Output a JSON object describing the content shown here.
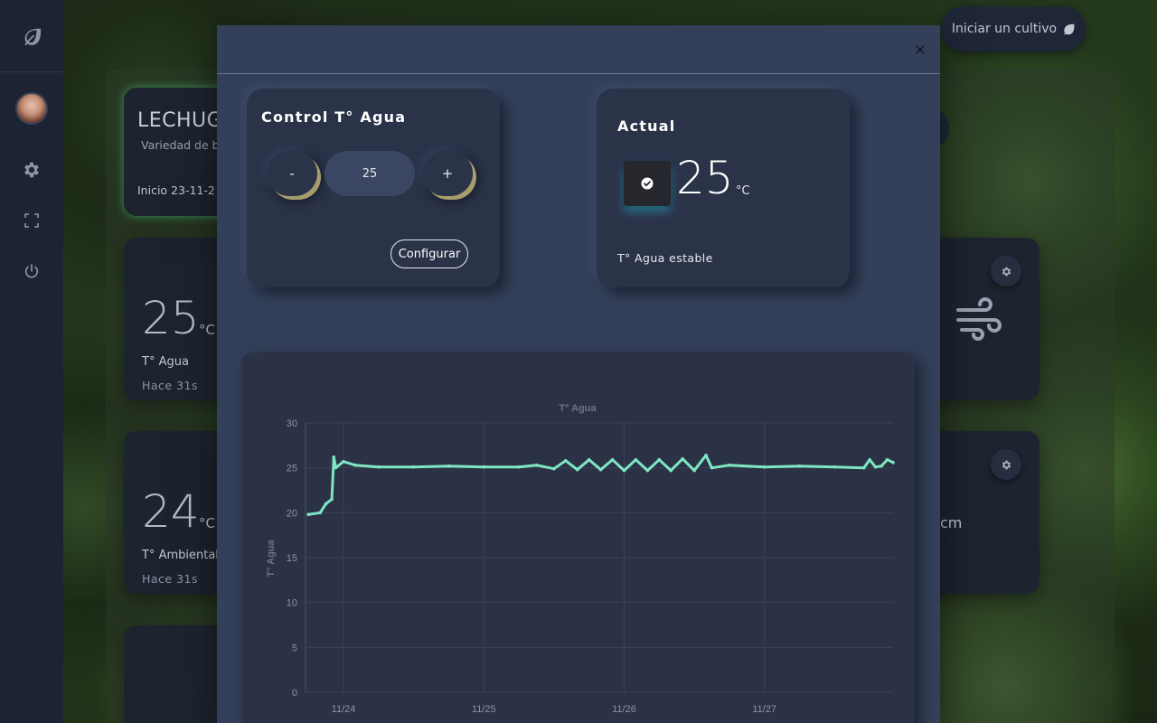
{
  "sidebar": {
    "items": [
      {
        "name": "leaf-icon"
      },
      {
        "name": "avatar"
      },
      {
        "name": "gear-icon"
      },
      {
        "name": "fullscreen-icon"
      },
      {
        "name": "power-icon"
      }
    ]
  },
  "header": {
    "start_button_label": "Iniciar un cultivo"
  },
  "crop_card": {
    "name": "LECHUG",
    "description": "Variedad de b otras",
    "start": "Inicio 23-11-2"
  },
  "metric_cards": [
    {
      "value": "25",
      "unit": "°C",
      "label": "T° Agua",
      "ago": "Hace 31s"
    },
    {
      "value": "24",
      "unit": "°C",
      "label": "T° Ambiental",
      "ago": "Hace 31s"
    }
  ],
  "right_cards": [
    {
      "icon": "wind-icon"
    },
    {
      "unit_text": "cm"
    }
  ],
  "modal": {
    "close_symbol": "×",
    "control": {
      "title": "Control T° Agua",
      "minus_label": "-",
      "value": "25",
      "plus_label": "+",
      "configure_label": "Configurar"
    },
    "actual": {
      "title": "Actual",
      "value": "25",
      "unit": "°C",
      "status_text": "T° Agua estable",
      "status_color": "#2ec8e6"
    }
  },
  "chart_data": {
    "type": "line",
    "title": "T° Agua",
    "ylabel": "T° Agua",
    "xlabel": "",
    "ylim": [
      0,
      30
    ],
    "yticks": [
      0,
      5,
      10,
      15,
      20,
      25,
      30
    ],
    "xlim": [
      "2023-11-23T17:30",
      "2023-11-27T22:00"
    ],
    "xticks": [
      {
        "label": "11/24",
        "date": "2023-11-24"
      },
      {
        "label": "11/25",
        "date": "2023-11-25"
      },
      {
        "label": "11/26",
        "date": "2023-11-26"
      },
      {
        "label": "11/27",
        "date": "2023-11-27"
      }
    ],
    "line_color": "#7ee6c2",
    "grid": true,
    "series": [
      {
        "points": [
          {
            "x": "2023-11-23T18:00",
            "y": 19.8
          },
          {
            "x": "2023-11-23T20:00",
            "y": 20.0
          },
          {
            "x": "2023-11-23T21:00",
            "y": 21.0
          },
          {
            "x": "2023-11-23T22:00",
            "y": 21.5
          },
          {
            "x": "2023-11-23T22:20",
            "y": 26.2
          },
          {
            "x": "2023-11-23T22:40",
            "y": 25.0
          },
          {
            "x": "2023-11-24T00:00",
            "y": 25.7
          },
          {
            "x": "2023-11-24T02:00",
            "y": 25.3
          },
          {
            "x": "2023-11-24T06:00",
            "y": 25.1
          },
          {
            "x": "2023-11-24T12:00",
            "y": 25.1
          },
          {
            "x": "2023-11-24T18:00",
            "y": 25.2
          },
          {
            "x": "2023-11-25T00:00",
            "y": 25.1
          },
          {
            "x": "2023-11-25T06:00",
            "y": 25.1
          },
          {
            "x": "2023-11-25T09:00",
            "y": 25.3
          },
          {
            "x": "2023-11-25T12:00",
            "y": 24.9
          },
          {
            "x": "2023-11-25T14:00",
            "y": 25.8
          },
          {
            "x": "2023-11-25T16:00",
            "y": 24.8
          },
          {
            "x": "2023-11-25T18:00",
            "y": 25.9
          },
          {
            "x": "2023-11-25T20:00",
            "y": 24.8
          },
          {
            "x": "2023-11-25T22:00",
            "y": 25.9
          },
          {
            "x": "2023-11-26T00:00",
            "y": 24.7
          },
          {
            "x": "2023-11-26T02:00",
            "y": 25.9
          },
          {
            "x": "2023-11-26T04:00",
            "y": 24.7
          },
          {
            "x": "2023-11-26T06:00",
            "y": 25.9
          },
          {
            "x": "2023-11-26T08:00",
            "y": 24.7
          },
          {
            "x": "2023-11-26T10:00",
            "y": 26.0
          },
          {
            "x": "2023-11-26T12:00",
            "y": 24.7
          },
          {
            "x": "2023-11-26T14:00",
            "y": 26.4
          },
          {
            "x": "2023-11-26T15:00",
            "y": 25.0
          },
          {
            "x": "2023-11-26T18:00",
            "y": 25.3
          },
          {
            "x": "2023-11-27T00:00",
            "y": 25.1
          },
          {
            "x": "2023-11-27T06:00",
            "y": 25.2
          },
          {
            "x": "2023-11-27T12:00",
            "y": 25.1
          },
          {
            "x": "2023-11-27T17:00",
            "y": 25.0
          },
          {
            "x": "2023-11-27T18:00",
            "y": 25.9
          },
          {
            "x": "2023-11-27T19:00",
            "y": 25.1
          },
          {
            "x": "2023-11-27T20:00",
            "y": 25.2
          },
          {
            "x": "2023-11-27T21:00",
            "y": 25.9
          },
          {
            "x": "2023-11-27T22:00",
            "y": 25.6
          }
        ]
      }
    ]
  }
}
